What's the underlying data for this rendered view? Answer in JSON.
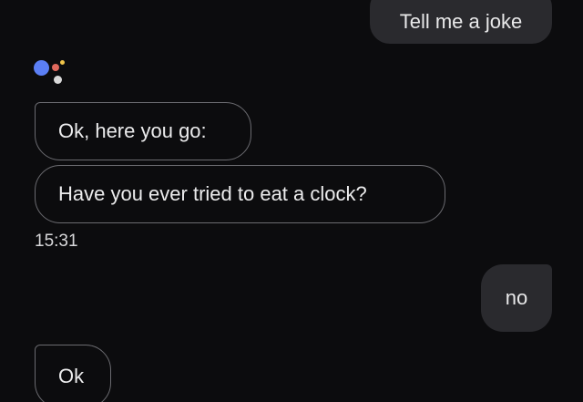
{
  "conversation": {
    "messages": [
      {
        "sender": "user",
        "text": "Tell me a joke"
      },
      {
        "sender": "assistant",
        "text": "Ok, here you go:"
      },
      {
        "sender": "assistant",
        "text": "Have you ever tried to eat a clock?"
      },
      {
        "sender": "user",
        "text": "no"
      },
      {
        "sender": "assistant",
        "text": "Ok"
      }
    ],
    "timestamp": "15:31"
  },
  "assistant_logo": {
    "icon": "google-assistant-logo-icon",
    "colors": [
      "#5b7ff5",
      "#e0695d",
      "#f1c54a",
      "#d9d9d9"
    ]
  },
  "colors": {
    "background": "#0c0c0e",
    "user_bubble": "#2a2a2e",
    "assistant_outline": "#6b6b70",
    "text": "#ececed"
  }
}
